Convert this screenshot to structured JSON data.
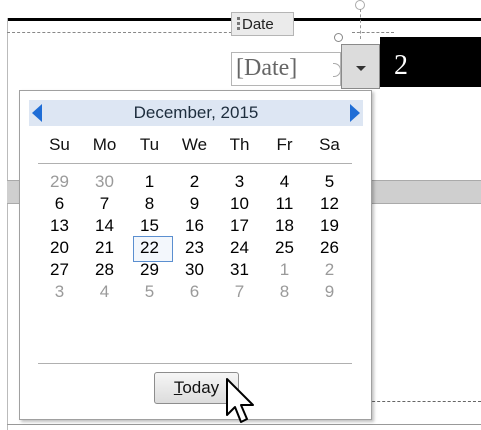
{
  "document": {
    "table_cell_text": "2"
  },
  "content_control": {
    "tag_label": "Date",
    "placeholder_text": "[Date]",
    "dropdown_icon": "chevron-down-icon"
  },
  "calendar": {
    "month_year": "December, 2015",
    "prev_icon": "triangle-left-icon",
    "next_icon": "triangle-right-icon",
    "weekdays": [
      "Su",
      "Mo",
      "Tu",
      "We",
      "Th",
      "Fr",
      "Sa"
    ],
    "weeks": [
      [
        {
          "d": "29",
          "other": true
        },
        {
          "d": "30",
          "other": true
        },
        {
          "d": "1"
        },
        {
          "d": "2"
        },
        {
          "d": "3"
        },
        {
          "d": "4"
        },
        {
          "d": "5"
        }
      ],
      [
        {
          "d": "6"
        },
        {
          "d": "7"
        },
        {
          "d": "8"
        },
        {
          "d": "9"
        },
        {
          "d": "10"
        },
        {
          "d": "11"
        },
        {
          "d": "12"
        }
      ],
      [
        {
          "d": "13"
        },
        {
          "d": "14"
        },
        {
          "d": "15"
        },
        {
          "d": "16"
        },
        {
          "d": "17"
        },
        {
          "d": "18"
        },
        {
          "d": "19"
        }
      ],
      [
        {
          "d": "20"
        },
        {
          "d": "21"
        },
        {
          "d": "22",
          "today": true
        },
        {
          "d": "23"
        },
        {
          "d": "24"
        },
        {
          "d": "25"
        },
        {
          "d": "26"
        }
      ],
      [
        {
          "d": "27"
        },
        {
          "d": "28"
        },
        {
          "d": "29"
        },
        {
          "d": "30"
        },
        {
          "d": "31"
        },
        {
          "d": "1",
          "other": true
        },
        {
          "d": "2",
          "other": true
        }
      ],
      [
        {
          "d": "3",
          "other": true
        },
        {
          "d": "4",
          "other": true
        },
        {
          "d": "5",
          "other": true
        },
        {
          "d": "6",
          "other": true
        },
        {
          "d": "7",
          "other": true
        },
        {
          "d": "8",
          "other": true
        },
        {
          "d": "9",
          "other": true
        }
      ]
    ],
    "today_button": {
      "accel": "T",
      "rest": "oday"
    },
    "colors": {
      "header_bg": "#dde6f3",
      "nav_arrow": "#1f6dd6",
      "today_border": "#5b8fd0",
      "other_month": "#9a9a9a"
    }
  }
}
